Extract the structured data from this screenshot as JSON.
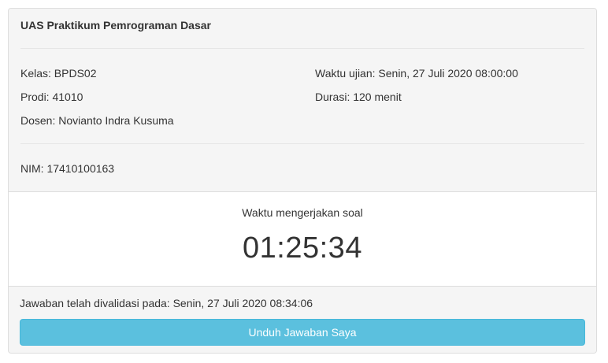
{
  "exam": {
    "title": "UAS Praktikum Pemrograman Dasar",
    "kelas": "Kelas: BPDS02",
    "prodi": "Prodi: 41010",
    "dosen": "Dosen: Novianto Indra Kusuma",
    "waktu_ujian": "Waktu ujian: Senin, 27 Juli 2020 08:00:00",
    "durasi": "Durasi: 120 menit",
    "nim": "NIM: 17410100163"
  },
  "timer": {
    "label": "Waktu mengerjakan soal",
    "value": "01:25:34"
  },
  "footer": {
    "validated_text": "Jawaban telah divalidasi pada: Senin, 27 Juli 2020 08:34:06",
    "download_label": "Unduh Jawaban Saya"
  },
  "colors": {
    "button_bg": "#5bc0de",
    "panel_bg": "#f5f5f5"
  }
}
